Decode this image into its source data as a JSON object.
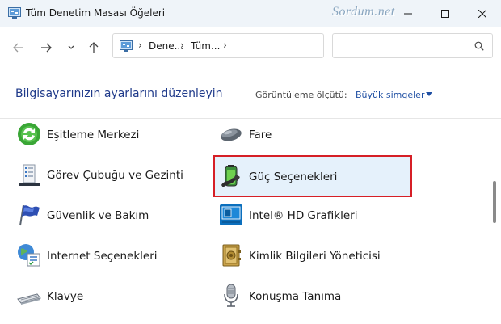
{
  "window": {
    "title": "Tüm Denetim Masası Öğeleri",
    "watermark": "Sordum.net"
  },
  "address": {
    "crumbs": [
      "Dene...",
      "Tüm..."
    ]
  },
  "header": {
    "heading": "Bilgisayarınızın ayarlarını düzenleyin",
    "view_label": "Görüntüleme ölçütü:",
    "view_value": "Büyük simgeler"
  },
  "items": {
    "left": [
      {
        "label": "Eşitleme Merkezi",
        "icon": "sync-center-icon"
      },
      {
        "label": "Görev Çubuğu ve Gezinti",
        "icon": "taskbar-icon"
      },
      {
        "label": "Güvenlik ve Bakım",
        "icon": "security-flag-icon"
      },
      {
        "label": "Internet Seçenekleri",
        "icon": "internet-options-icon"
      },
      {
        "label": "Klavye",
        "icon": "keyboard-icon"
      }
    ],
    "right": [
      {
        "label": "Fare",
        "icon": "mouse-icon"
      },
      {
        "label": "Güç Seçenekleri",
        "icon": "power-options-icon",
        "selected": true
      },
      {
        "label": "Intel® HD Grafikleri",
        "icon": "intel-graphics-icon"
      },
      {
        "label": "Kimlik Bilgileri Yöneticisi",
        "icon": "credential-manager-icon"
      },
      {
        "label": "Konuşma Tanıma",
        "icon": "microphone-icon"
      }
    ]
  },
  "colors": {
    "selection_border": "#d61f26",
    "selection_fill": "#e5f1fb",
    "link_blue": "#1f4fa3",
    "heading_blue": "#1f3a8a"
  }
}
